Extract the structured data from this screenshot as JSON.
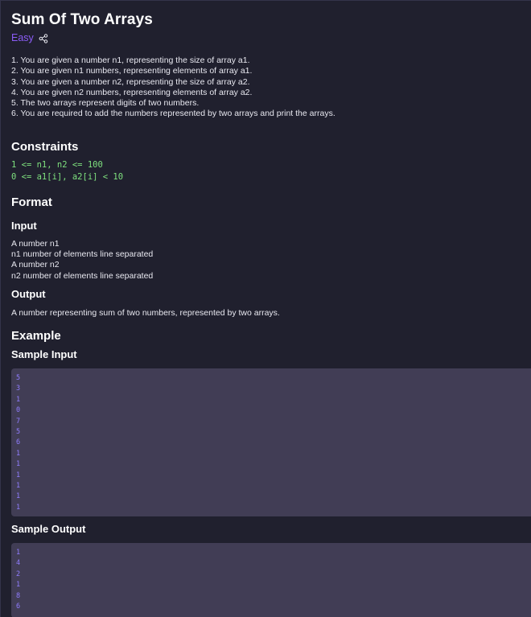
{
  "problem": {
    "title": "Sum Of Two Arrays",
    "difficulty": "Easy",
    "description": [
      "1. You are given a number n1, representing the size of array a1.",
      "2. You are given n1 numbers, representing elements of array a1.",
      "3. You are given a number n2, representing the size of array a2.",
      "4. You are given n2 numbers, representing elements of array a2.",
      "5. The two arrays represent digits of two numbers.",
      "6. You are required to add the numbers represented by two arrays and print the arrays."
    ]
  },
  "constraints": {
    "heading": "Constraints",
    "lines": [
      "1 <= n1, n2 <= 100",
      "0 <= a1[i], a2[i] < 10"
    ]
  },
  "format": {
    "heading": "Format",
    "input_heading": "Input",
    "input_lines": [
      "A number n1",
      "n1 number of elements line separated",
      "A number n2",
      "n2 number of elements line separated"
    ],
    "output_heading": "Output",
    "output_text": "A number representing sum of two numbers, represented by two arrays."
  },
  "example": {
    "heading": "Example",
    "sample_input_heading": "Sample Input",
    "sample_input": [
      "5",
      "3",
      "1",
      "0",
      "7",
      "5",
      "6",
      "1",
      "1",
      "1",
      "1",
      "1",
      "1"
    ],
    "sample_output_heading": "Sample Output",
    "sample_output": [
      "1",
      "4",
      "2",
      "1",
      "8",
      "6"
    ]
  },
  "colors": {
    "background": "#20202e",
    "accent": "#8b5cf6",
    "code_green": "#7ee07e",
    "io_box": "#413d55"
  },
  "icons": {
    "share": "share-icon"
  }
}
